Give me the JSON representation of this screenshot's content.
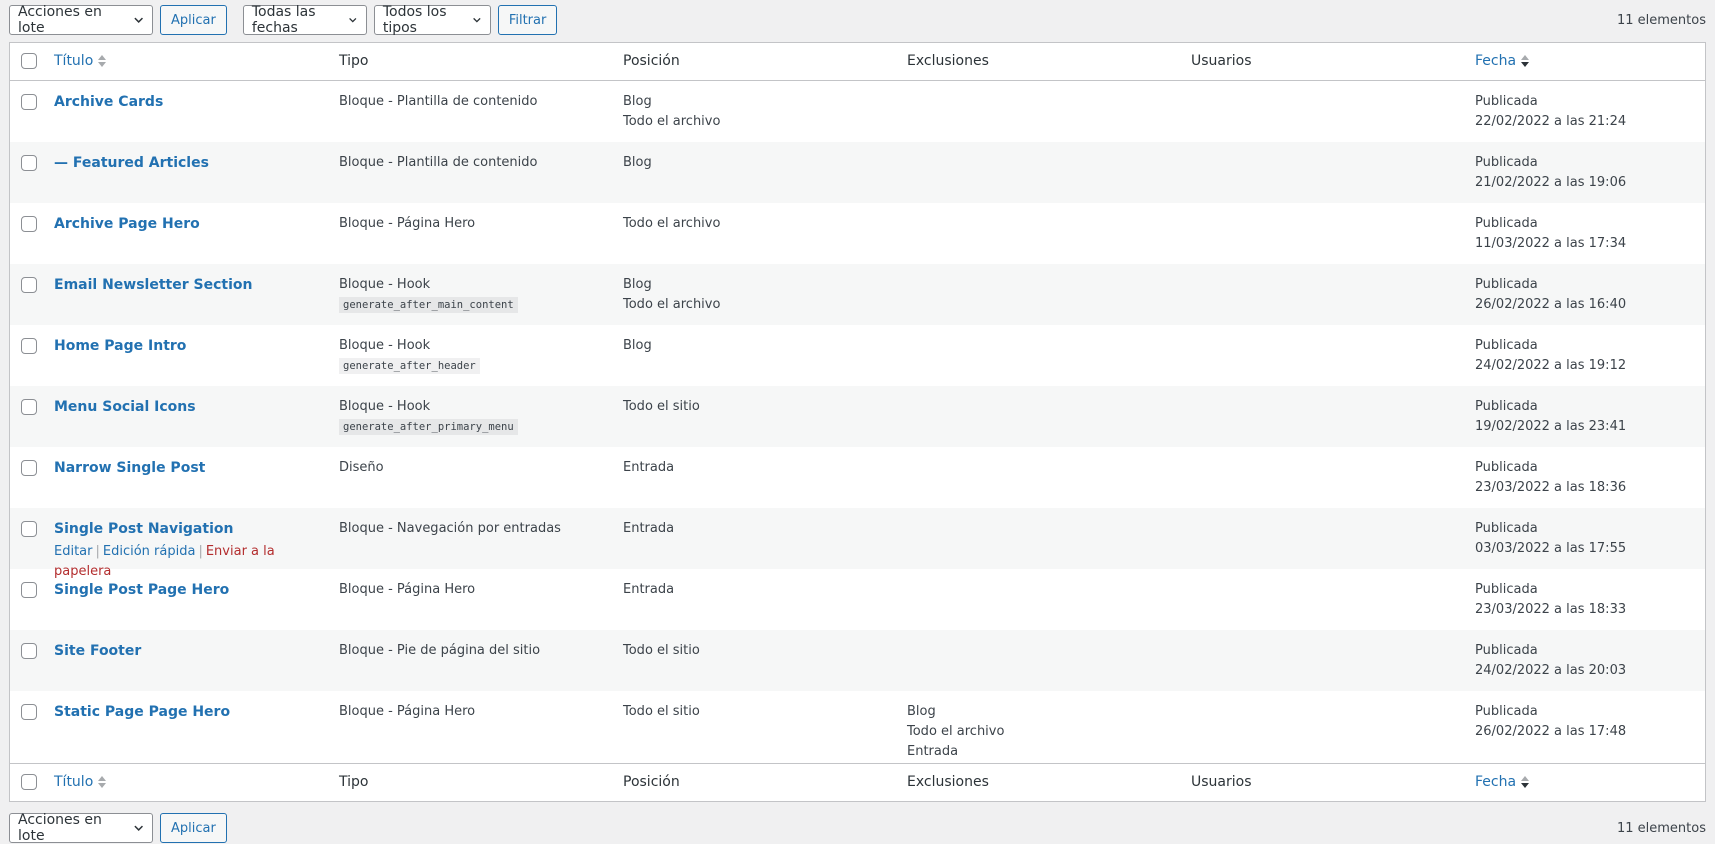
{
  "toolbar": {
    "bulk_label": "Acciones en lote",
    "apply_label": "Aplicar",
    "dates_label": "Todas las fechas",
    "types_label": "Todos los tipos",
    "filter_label": "Filtrar",
    "count_label": "11 elementos"
  },
  "columns": {
    "title": "Título",
    "type": "Tipo",
    "position": "Posición",
    "exclusions": "Exclusiones",
    "users": "Usuarios",
    "date": "Fecha"
  },
  "rows": [
    {
      "title": "Archive Cards",
      "type": "Bloque - Plantilla de contenido",
      "hook": "",
      "pos1": "Blog",
      "pos2": "Todo el archivo",
      "exc1": "",
      "exc2": "",
      "exc3": "",
      "status": "Publicada",
      "date": "22/02/2022 a las 21:24"
    },
    {
      "title": "— Featured Articles",
      "type": "Bloque - Plantilla de contenido",
      "hook": "",
      "pos1": "Blog",
      "pos2": "",
      "exc1": "",
      "exc2": "",
      "exc3": "",
      "status": "Publicada",
      "date": "21/02/2022 a las 19:06"
    },
    {
      "title": "Archive Page Hero",
      "type": "Bloque - Página Hero",
      "hook": "",
      "pos1": "Todo el archivo",
      "pos2": "",
      "exc1": "",
      "exc2": "",
      "exc3": "",
      "status": "Publicada",
      "date": "11/03/2022 a las 17:34"
    },
    {
      "title": "Email Newsletter Section",
      "type": "Bloque - Hook",
      "hook": "generate_after_main_content",
      "pos1": "Blog",
      "pos2": "Todo el archivo",
      "exc1": "",
      "exc2": "",
      "exc3": "",
      "status": "Publicada",
      "date": "26/02/2022 a las 16:40"
    },
    {
      "title": "Home Page Intro",
      "type": "Bloque - Hook",
      "hook": "generate_after_header",
      "pos1": "Blog",
      "pos2": "",
      "exc1": "",
      "exc2": "",
      "exc3": "",
      "status": "Publicada",
      "date": "24/02/2022 a las 19:12"
    },
    {
      "title": "Menu Social Icons",
      "type": "Bloque - Hook",
      "hook": "generate_after_primary_menu",
      "pos1": "Todo el sitio",
      "pos2": "",
      "exc1": "",
      "exc2": "",
      "exc3": "",
      "status": "Publicada",
      "date": "19/02/2022 a las 23:41"
    },
    {
      "title": "Narrow Single Post",
      "type": "Diseño",
      "hook": "",
      "pos1": "Entrada",
      "pos2": "",
      "exc1": "",
      "exc2": "",
      "exc3": "",
      "status": "Publicada",
      "date": "23/03/2022 a las 18:36"
    },
    {
      "title": "Single Post Navigation",
      "type": "Bloque - Navegación por entradas",
      "hook": "",
      "pos1": "Entrada",
      "pos2": "",
      "exc1": "",
      "exc2": "",
      "exc3": "",
      "status": "Publicada",
      "date": "03/03/2022 a las 17:55"
    },
    {
      "title": "Single Post Page Hero",
      "type": "Bloque - Página Hero",
      "hook": "",
      "pos1": "Entrada",
      "pos2": "",
      "exc1": "",
      "exc2": "",
      "exc3": "",
      "status": "Publicada",
      "date": "23/03/2022 a las 18:33"
    },
    {
      "title": "Site Footer",
      "type": "Bloque - Pie de página del sitio",
      "hook": "",
      "pos1": "Todo el sitio",
      "pos2": "",
      "exc1": "",
      "exc2": "",
      "exc3": "",
      "status": "Publicada",
      "date": "24/02/2022 a las 20:03"
    },
    {
      "title": "Static Page Page Hero",
      "type": "Bloque - Página Hero",
      "hook": "",
      "pos1": "Todo el sitio",
      "pos2": "",
      "exc1": "Blog",
      "exc2": "Todo el archivo",
      "exc3": "Entrada",
      "status": "Publicada",
      "date": "26/02/2022 a las 17:48"
    }
  ],
  "row_actions": {
    "edit": "Editar",
    "quick_edit": "Edición rápida",
    "trash": "Enviar a la papelera"
  },
  "colors": {
    "link": "#2271b1",
    "trash": "#b32d2e",
    "alt_row": "#f6f7f7"
  }
}
